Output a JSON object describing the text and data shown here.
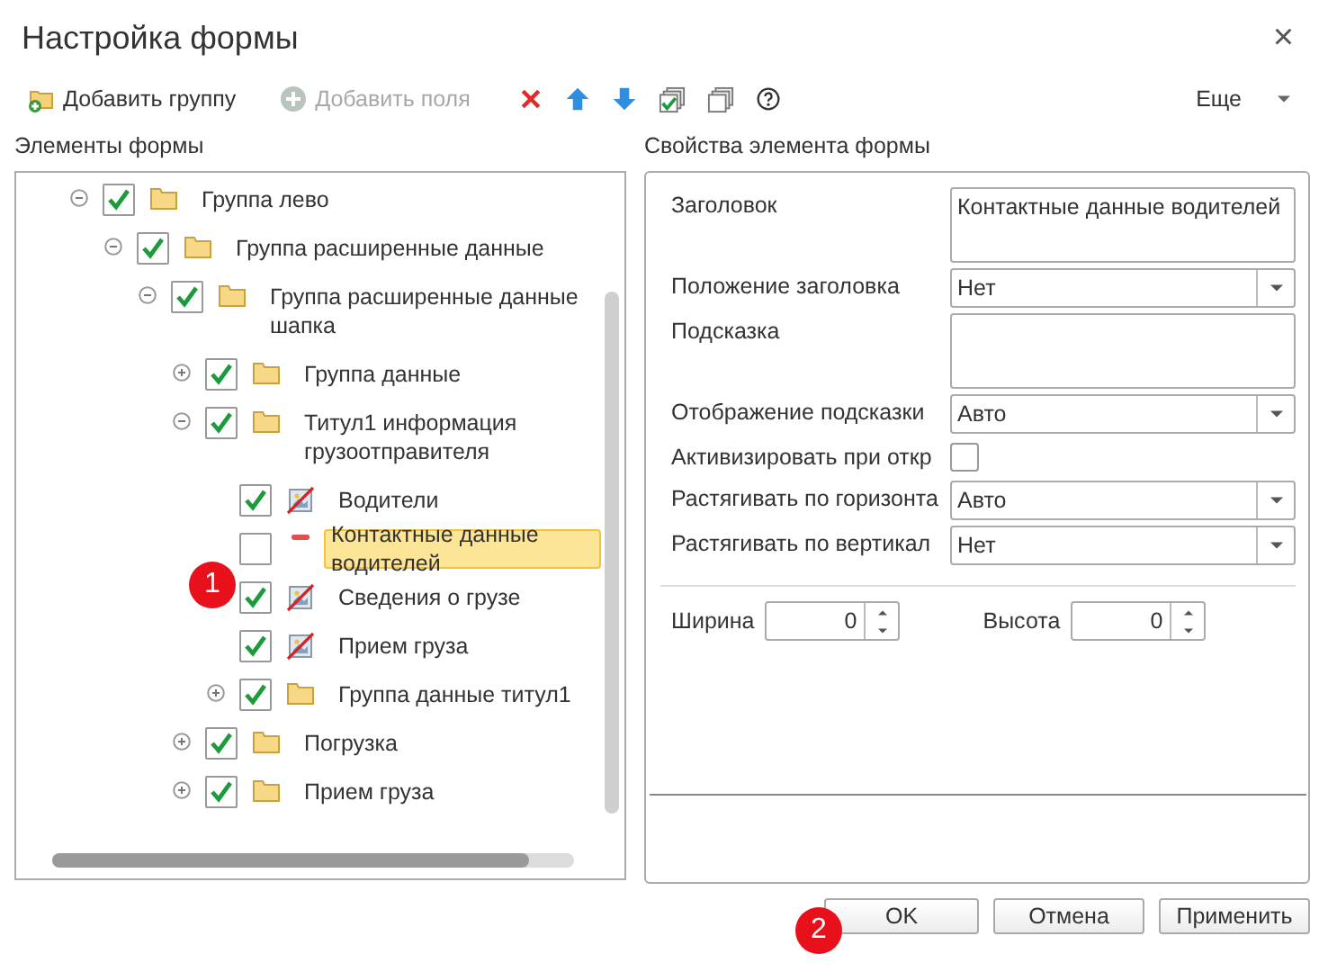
{
  "window": {
    "title": "Настройка формы",
    "close": "×"
  },
  "toolbar": {
    "buttons": [
      {
        "kind": "add-group",
        "label": "Добавить группу",
        "disabled": false
      },
      {
        "kind": "add-field",
        "label": "Добавить поля",
        "disabled": true
      }
    ],
    "icons": [
      {
        "kind": "delete"
      },
      {
        "kind": "up"
      },
      {
        "kind": "down"
      },
      {
        "kind": "check-all"
      },
      {
        "kind": "uncheck-all"
      },
      {
        "kind": "help"
      }
    ],
    "more": "Еще"
  },
  "tree": {
    "title": "Элементы формы",
    "items": [
      {
        "label": "Группа лево",
        "kind": "folder",
        "checked": true,
        "expanded": true,
        "selected": false,
        "children": [
          {
            "label": "Группа расширенные данные",
            "kind": "folder",
            "checked": true,
            "expanded": true,
            "selected": false,
            "children": [
              {
                "label": "Группа расширенные данные шапка",
                "kind": "folder",
                "checked": true,
                "expanded": true,
                "selected": false,
                "children": [
                  {
                    "label": "Группа данные",
                    "kind": "folder",
                    "checked": true,
                    "expanded": false,
                    "selected": false
                  },
                  {
                    "label": "Титул1 информация грузоотправителя",
                    "kind": "folder",
                    "checked": true,
                    "expanded": true,
                    "selected": false,
                    "children": [
                      {
                        "label": "Водители",
                        "kind": "field",
                        "checked": true,
                        "selected": false
                      },
                      {
                        "label": "Контактные данные водителей",
                        "kind": "decoration",
                        "checked": false,
                        "selected": true
                      },
                      {
                        "label": "Сведения о грузе",
                        "kind": "field",
                        "checked": true,
                        "selected": false
                      },
                      {
                        "label": "Прием груза",
                        "kind": "field",
                        "checked": true,
                        "selected": false
                      },
                      {
                        "label": "Группа данные титул1",
                        "kind": "folder",
                        "checked": true,
                        "expanded": false,
                        "selected": false
                      }
                    ]
                  },
                  {
                    "label": "Погрузка",
                    "kind": "folder",
                    "checked": true,
                    "expanded": false,
                    "selected": false
                  },
                  {
                    "label": "Прием груза",
                    "kind": "folder",
                    "checked": true,
                    "expanded": false,
                    "selected": false
                  }
                ]
              }
            ]
          }
        ]
      }
    ]
  },
  "properties": {
    "title": "Свойства элемента формы",
    "rows": [
      {
        "label": "Заголовок",
        "kind": "textarea",
        "value": "Контактные данные водителей"
      },
      {
        "label": "Положение заголовка",
        "kind": "select",
        "value": "Нет"
      },
      {
        "label": "Подсказка",
        "kind": "textarea"
      },
      {
        "label": "Отображение подсказки",
        "kind": "select",
        "value": "Авто"
      },
      {
        "label": "Активизировать при откр",
        "kind": "checkbox",
        "checked": false
      },
      {
        "label": "Растягивать по горизонта",
        "kind": "select",
        "value": "Авто"
      },
      {
        "label": "Растягивать по вертикал",
        "kind": "select",
        "value": "Нет"
      }
    ],
    "size": [
      {
        "label": "Ширина",
        "value": "0"
      },
      {
        "label": "Высота",
        "value": "0"
      }
    ]
  },
  "buttons": [
    "OK",
    "Отмена",
    "Применить"
  ],
  "callouts": [
    "1",
    "2"
  ]
}
